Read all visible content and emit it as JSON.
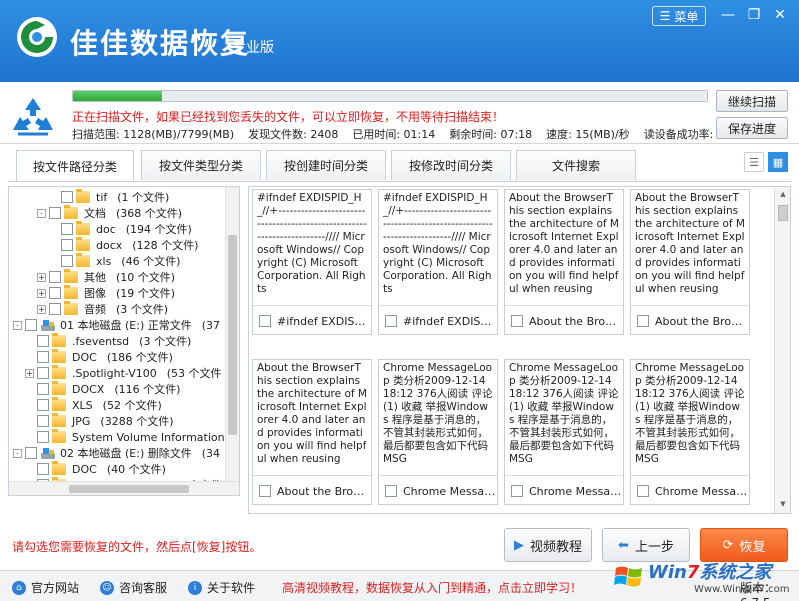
{
  "app": {
    "title": "佳佳数据恢复",
    "edition": "专业版",
    "menu_label": "菜单"
  },
  "scan": {
    "progress_percent": 14,
    "message": "正在扫描文件，如果已经找到您丢失的文件，可以立即恢复，不用等待扫描结束！",
    "stats": [
      "扫描范围: 1128(MB)/7799(MB)",
      "发现文件数: 2408",
      "已用时间: 01:14",
      "剩余时间: 07:18",
      "速度: 15(MB)/秒",
      "读设备成功率:"
    ],
    "continue_label": "继续扫描",
    "save_label": "保存进度"
  },
  "tabs": [
    {
      "label": "按文件路径分类",
      "active": true
    },
    {
      "label": "按文件类型分类",
      "active": false
    },
    {
      "label": "按创建时间分类",
      "active": false
    },
    {
      "label": "按修改时间分类",
      "active": false
    },
    {
      "label": "文件搜索",
      "active": false
    }
  ],
  "tree": [
    {
      "indent": 4,
      "expander": "",
      "icon": "folder",
      "name": "tif",
      "count": "(1 个文件)"
    },
    {
      "indent": 3,
      "expander": "-",
      "icon": "folder",
      "name": "文档",
      "count": "(368 个文件)"
    },
    {
      "indent": 4,
      "expander": "",
      "icon": "folder",
      "name": "doc",
      "count": "(194 个文件)"
    },
    {
      "indent": 4,
      "expander": "",
      "icon": "folder",
      "name": "docx",
      "count": "(128 个文件)"
    },
    {
      "indent": 4,
      "expander": "",
      "icon": "folder",
      "name": "xls",
      "count": "(46 个文件)"
    },
    {
      "indent": 3,
      "expander": "+",
      "icon": "folder",
      "name": "其他",
      "count": "(10 个文件)"
    },
    {
      "indent": 3,
      "expander": "+",
      "icon": "folder",
      "name": "图像",
      "count": "(19 个文件)"
    },
    {
      "indent": 3,
      "expander": "+",
      "icon": "folder",
      "name": "音频",
      "count": "(3 个文件)"
    },
    {
      "indent": 1,
      "expander": "-",
      "icon": "drive",
      "name": "01 本地磁盘 (E:) 正常文件",
      "count": "(37"
    },
    {
      "indent": 2,
      "expander": "",
      "icon": "folder",
      "name": ".fseventsd",
      "count": "(3 个文件)"
    },
    {
      "indent": 2,
      "expander": "",
      "icon": "folder",
      "name": "DOC",
      "count": "(186 个文件)"
    },
    {
      "indent": 2,
      "expander": "+",
      "icon": "folder",
      "name": ".Spotlight-V100",
      "count": "(53 个文件"
    },
    {
      "indent": 2,
      "expander": "",
      "icon": "folder",
      "name": "DOCX",
      "count": "(116 个文件)"
    },
    {
      "indent": 2,
      "expander": "",
      "icon": "folder",
      "name": "XLS",
      "count": "(52 个文件)"
    },
    {
      "indent": 2,
      "expander": "",
      "icon": "folder",
      "name": "JPG",
      "count": "(3288 个文件)"
    },
    {
      "indent": 2,
      "expander": "",
      "icon": "folder",
      "name": "System Volume Information",
      "count": ""
    },
    {
      "indent": 1,
      "expander": "-",
      "icon": "drive",
      "name": "02 本地磁盘 (E:) 删除文件",
      "count": "(34"
    },
    {
      "indent": 2,
      "expander": "",
      "icon": "folder",
      "name": "DOC",
      "count": "(40 个文件)"
    },
    {
      "indent": 2,
      "expander": "+",
      "icon": "folder",
      "name": ".Spotlight-V100",
      "count": "(18 个文件"
    }
  ],
  "files": [
    {
      "preview": "#ifndef EXDISPID_H_//+----------------------------------------------------------------------//// Microsoft Windows// Copyright (C) Microsoft Corporation. All Rights",
      "name": "#ifndef EXDISPID_H_"
    },
    {
      "preview": "#ifndef EXDISPID_H_//+----------------------------------------------------------------------//// Microsoft Windows// Copyright (C) Microsoft Corporation. All Rights",
      "name": "#ifndef EXDISPID_H_"
    },
    {
      "preview": "About the BrowserThis section explains the architecture of Microsoft Internet Explorer 4.0 and later and provides information you will find helpful when reusing",
      "name": "About the BrowserThis"
    },
    {
      "preview": "About the BrowserThis section explains the architecture of Microsoft Internet Explorer 4.0 and later and provides information you will find helpful when reusing",
      "name": "About the BrowserThis"
    },
    {
      "preview": "About the BrowserThis section explains the architecture of Microsoft Internet Explorer 4.0 and later and provides information you will find helpful when reusing",
      "name": "About the BrowserThis"
    },
    {
      "preview": "Chrome MessageLoop 类分析2009-12-14 18:12 376人阅读 评论(1) 收藏 举报Windows 程序是基于消息的，不管其封装形式如何，最后都要包含如下代码MSG",
      "name": "Chrome MessageLoop"
    },
    {
      "preview": "Chrome MessageLoop 类分析2009-12-14 18:12 376人阅读 评论(1) 收藏 举报Windows 程序是基于消息的，不管其封装形式如何，最后都要包含如下代码MSG",
      "name": "Chrome MessageLoop"
    },
    {
      "preview": "Chrome MessageLoop 类分析2009-12-14 18:12 376人阅读 评论(1) 收藏 举报Windows 程序是基于消息的，不管其封装形式如何，最后都要包含如下代码MSG",
      "name": "Chrome MessageLoop"
    }
  ],
  "actions": {
    "hint": "请勾选您需要恢复的文件，然后点[恢复]按钮。",
    "video_label": "视频教程",
    "prev_label": "上一步",
    "recover_label": "恢复"
  },
  "status": {
    "website": "官方网站",
    "support": "咨询客服",
    "about": "关于软件",
    "promo": "高清视频教程，数据恢复从入门到精通，点击立即学习！",
    "version": "版本：6.7.5"
  },
  "watermark": {
    "brand_a": "Win",
    "brand_b": "7",
    "brand_c": "系统之家",
    "url": "Www.Winwin7.com"
  },
  "colors": {
    "titlebar": "#2383d8",
    "accent_red": "#e02020",
    "recover_orange": "#f26a26"
  }
}
